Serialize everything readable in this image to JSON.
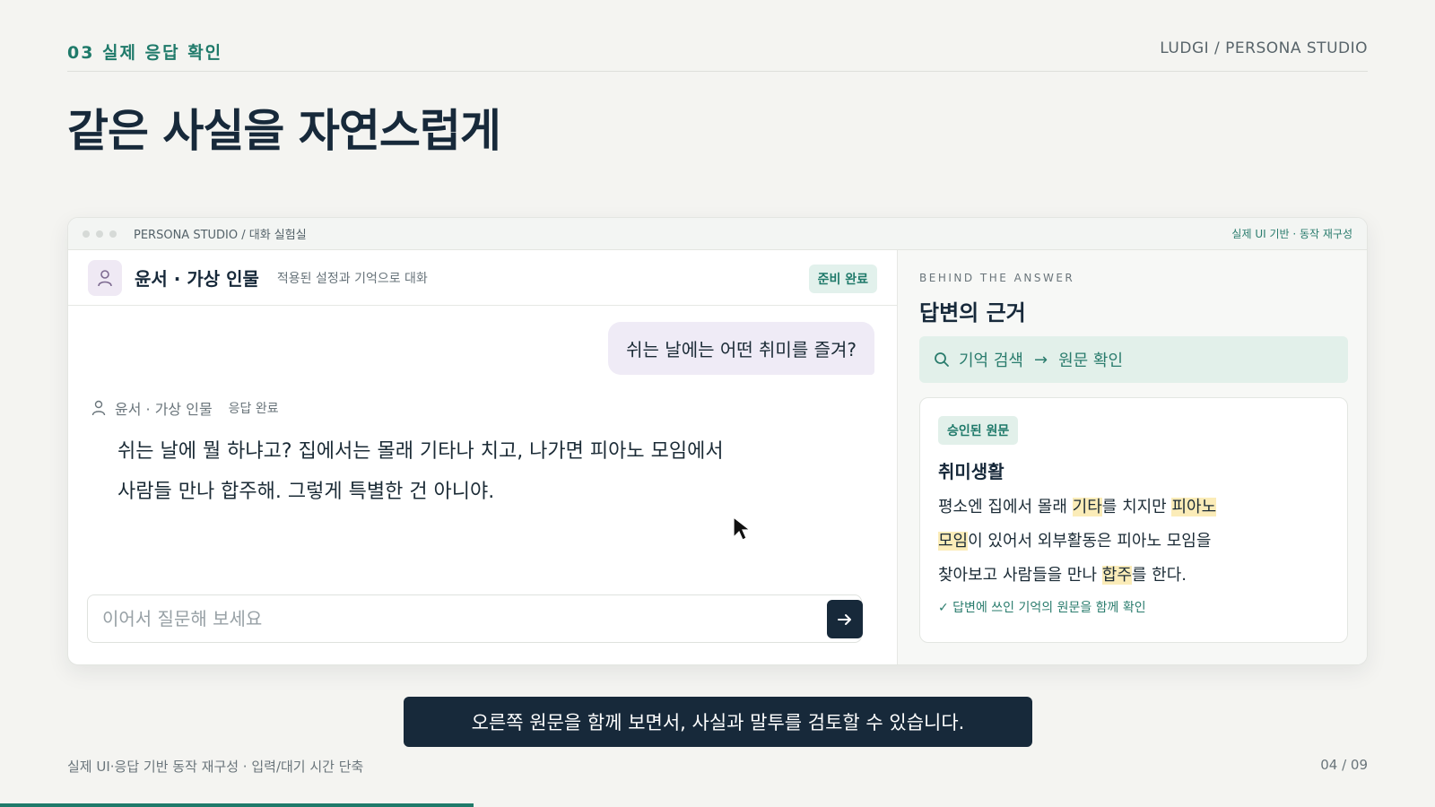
{
  "header": {
    "section_label": "03 실제 응답 확인",
    "brand": "LUDGI / PERSONA STUDIO",
    "title": "같은 사실을 자연스럽게"
  },
  "window": {
    "path": "PERSONA STUDIO / 대화 실험실",
    "meta": "실제 UI 기반 · 동작 재구성"
  },
  "chat": {
    "icon": "user-outline-icon",
    "persona_name": "윤서 · 가상 인물",
    "persona_desc": "적용된 설정과 기억으로 대화",
    "status": "준비 완료",
    "user_message": "쉬는 날에는 어떤 취미를 즐겨?",
    "reply_author": "윤서 · 가상 인물",
    "reply_status": "응답 완료",
    "reply_line1": "쉬는 날에 뭘 하냐고? 집에서는 몰래 기타나 치고, 나가면 피아노 모임에서",
    "reply_line2": "사람들 만나 합주해. 그렇게 특별한 건 아니야.",
    "input_placeholder": "이어서 질문해 보세요",
    "send_icon": "arrow-right-icon"
  },
  "behind": {
    "label": "BEHIND THE ANSWER",
    "title": "답변의 근거",
    "step1": "기억 검색",
    "step_sep": "→",
    "step2": "원문 확인",
    "card": {
      "badge": "승인된 원문",
      "title": "취미생활",
      "seg1": "평소엔 집에서 몰래 ",
      "hl1": "기타",
      "seg2": "를 치지만 ",
      "hl2": "피아노",
      "hl2b": "모임",
      "seg3": "이 있어서 외부활동은 피아노 모임을",
      "seg4": "찾아보고 사람들을 만나 ",
      "hl3": "합주",
      "seg5": "를 한다.",
      "note": "✓ 답변에 쓰인 기억의 원문을 함께 확인"
    }
  },
  "caption": "오른쪽 원문을 함께 보면서, 사실과 말투를 검토할 수 있습니다.",
  "footer": {
    "left": "실제 UI·응답 기반 동작 재구성 · 입력/대기 시간 단축",
    "page": "04 / 09"
  },
  "progress": {
    "fraction": 0.33
  },
  "colors": {
    "accent": "#1f7a6a",
    "dark": "#17293a",
    "highlight": "#fbecb8"
  }
}
